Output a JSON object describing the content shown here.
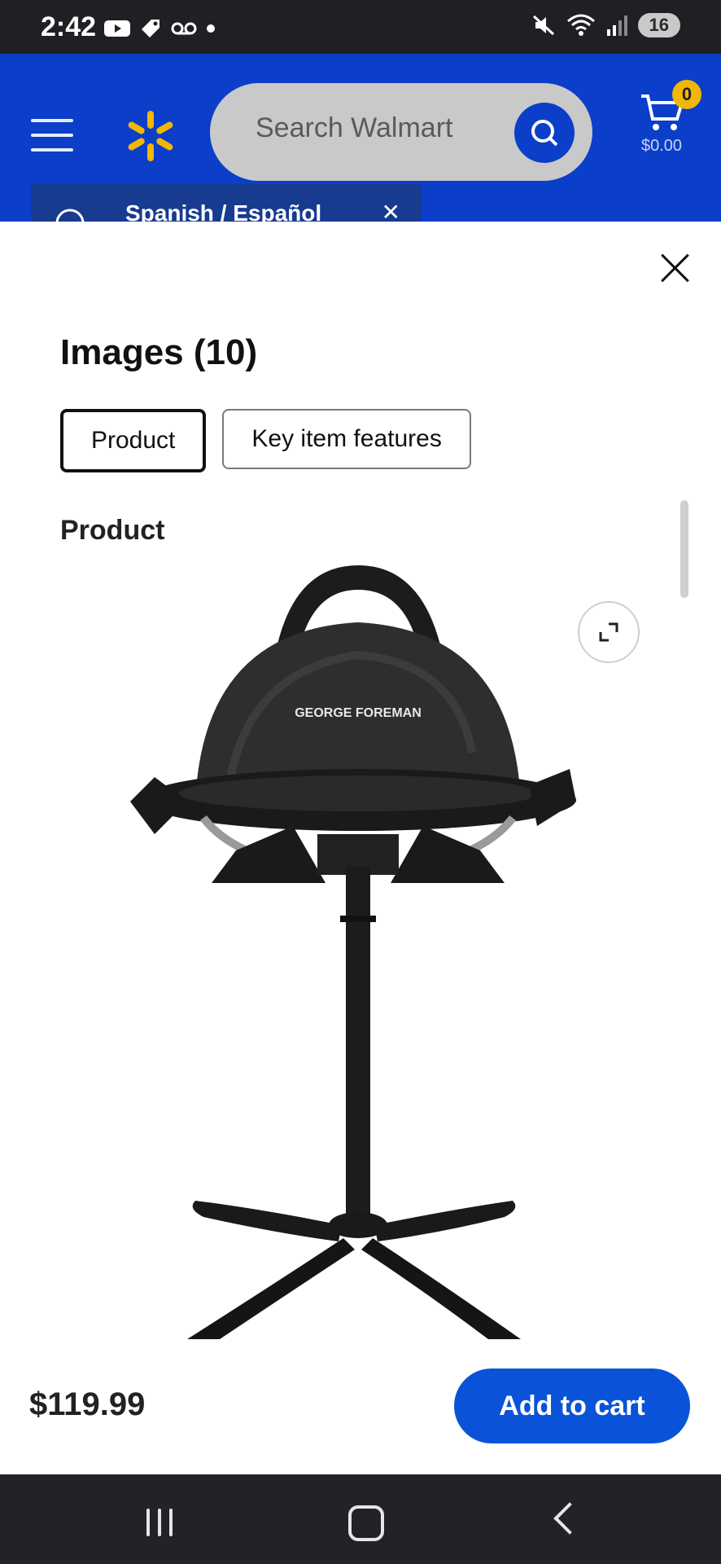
{
  "status_bar": {
    "time": "2:42",
    "battery": "16",
    "icons_left": [
      "youtube-icon",
      "tag-icon",
      "voicemail-icon",
      "dot-icon"
    ],
    "icons_right": [
      "mute-icon",
      "wifi-icon",
      "signal-icon",
      "battery-icon"
    ]
  },
  "header": {
    "search_placeholder": "Search Walmart",
    "cart_count": "0",
    "cart_total": "$0.00",
    "language_tooltip": "Spanish / Español"
  },
  "sheet": {
    "title": "Images (10)",
    "chips": [
      {
        "label": "Product",
        "active": true
      },
      {
        "label": "Key item features",
        "active": false
      }
    ],
    "section_label": "Product",
    "product_brand": "GEORGE FOREMAN"
  },
  "footer": {
    "price": "$119.99",
    "add_to_cart": "Add to cart"
  },
  "colors": {
    "walmart_blue": "#0b3ec9",
    "spark_yellow": "#f2b705",
    "cta_blue": "#0a53d8"
  }
}
